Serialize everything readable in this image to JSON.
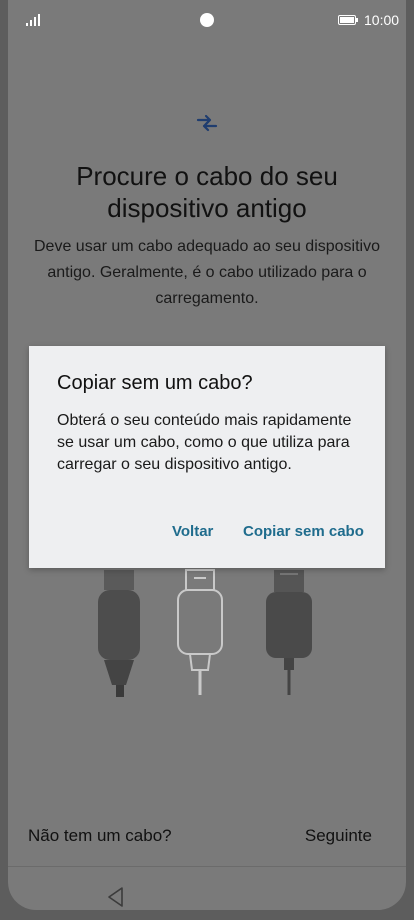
{
  "status_bar": {
    "time": "10:00"
  },
  "main": {
    "title": "Procure o cabo do seu dispositivo antigo",
    "description": "Deve usar um cabo adequado ao seu dispositivo antigo. Geralmente, é o cabo utilizado para o carregamento."
  },
  "dialog": {
    "title": "Copiar sem um cabo?",
    "message": "Obterá o seu conteúdo mais rapidamente se usar um cabo, como o que utiliza para carregar o seu dispositivo antigo.",
    "buttons": {
      "back": "Voltar",
      "copy_without_cable": "Copiar sem cabo"
    }
  },
  "footer": {
    "no_cable": "Não tem um cabo?",
    "next": "Seguinte"
  },
  "colors": {
    "accent": "#1f6c8d",
    "icon_blue": "#1f3d6f"
  },
  "icons": {
    "transfer": "transfer-arrows-icon",
    "back_nav": "back-triangle-icon"
  }
}
